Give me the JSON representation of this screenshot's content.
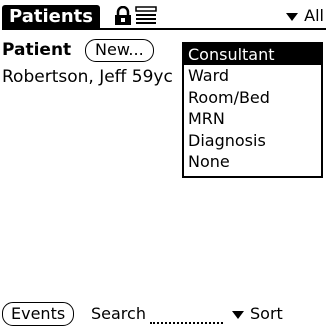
{
  "title": {
    "label": "Patients",
    "filter_label": "All"
  },
  "header": {
    "patient_label": "Patient",
    "new_button": "New..."
  },
  "patients": [
    {
      "name": "Robertson, Jeff 59yc"
    }
  ],
  "popup": {
    "items": [
      {
        "label": "Consultant",
        "selected": true
      },
      {
        "label": "Ward",
        "selected": false
      },
      {
        "label": "Room/Bed",
        "selected": false
      },
      {
        "label": "MRN",
        "selected": false
      },
      {
        "label": "Diagnosis",
        "selected": false
      },
      {
        "label": "None",
        "selected": false
      }
    ]
  },
  "footer": {
    "events_button": "Events",
    "search_label": "Search",
    "search_value": "",
    "sort_label": "Sort"
  },
  "icons": {
    "lock": "lock-icon",
    "list": "list-icon",
    "dropdown": "triangle-down-icon"
  }
}
